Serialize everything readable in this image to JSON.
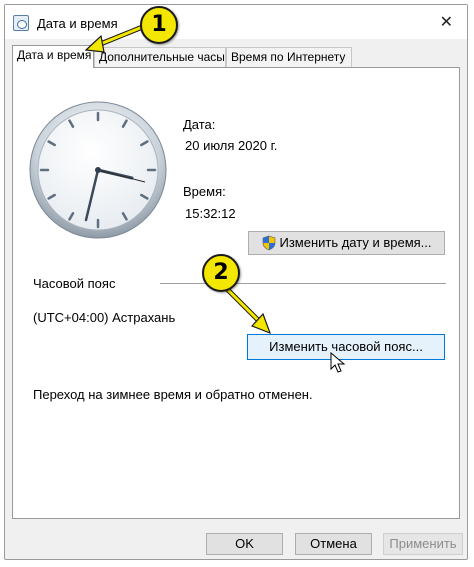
{
  "window": {
    "title": "Дата и время",
    "close_glyph": "✕"
  },
  "tabs": [
    {
      "label": "Дата и время",
      "active": true
    },
    {
      "label": "Дополнительные часы",
      "active": false
    },
    {
      "label": "Время по Интернету",
      "active": false
    }
  ],
  "datetime": {
    "date_label": "Дата:",
    "date_value": "20 июля 2020 г.",
    "time_label": "Время:",
    "time_value": "15:32:12",
    "change_button": "Изменить дату и время..."
  },
  "timezone": {
    "label": "Часовой пояс",
    "value": "(UTC+04:00) Астрахань",
    "change_button": "Изменить часовой пояс...",
    "dst_note": "Переход на зимнее время и обратно отменен."
  },
  "footer": {
    "ok": "OK",
    "cancel": "Отмена",
    "apply": "Применить"
  },
  "annotations": {
    "step1": "1",
    "step2": "2",
    "color": "#f3e600"
  },
  "icons": [
    "app-clock-icon",
    "close-icon",
    "uac-shield-icon",
    "mouse-cursor-icon"
  ]
}
